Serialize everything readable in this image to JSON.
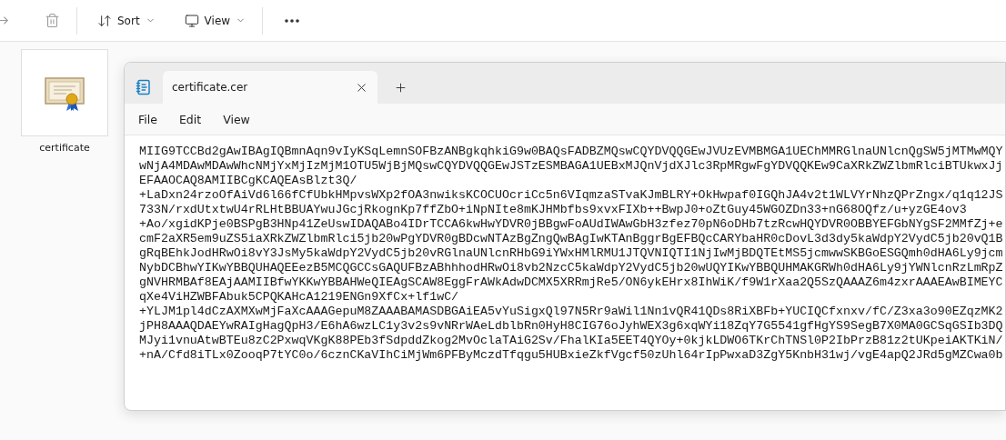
{
  "toolbar": {
    "items": [
      {
        "kind": "share"
      },
      {
        "kind": "delete"
      },
      {
        "kind": "sort",
        "label": "Sort"
      },
      {
        "kind": "view",
        "label": "View"
      },
      {
        "kind": "more"
      }
    ]
  },
  "file": {
    "name": "certificate"
  },
  "notepad": {
    "tabs": [
      {
        "title": "certificate.cer",
        "selected": true
      }
    ],
    "menu": [
      "File",
      "Edit",
      "View"
    ],
    "lines": [
      "MIIG9TCCBd2gAwIBAgIQBmnAqn9vIyKSqLemnSOFBzANBgkqhkiG9w0BAQsFADBZMQswCQYDVQQGEwJVUzEVMBMGA1UEChMMRGlnaUNlcnQgSW5jMTMwMQY",
      "wNjA4MDAwMDAwWhcNMjYxMjIzMjM1OTU5WjBjMQswCQYDVQQGEwJSTzESMBAGA1UEBxMJQnVjdXJlc3RpMRgwFgYDVQQKEw9CaXRkZWZlbmRlciBTUkwxJj",
      "EFAAOCAQ8AMIIBCgKCAQEAsBlzt3Q/",
      "+LaDxn24rzoOfAiVd6l66fCfUbkHMpvsWXp2fOA3nwiksKCOCUOcriCc5n6VIqmzaSTvaKJmBLRY+OkHwpaf0IGQhJA4v2t1WLVYrNhzQPrZngx/q1q12JS",
      "733N/rxdUtxtwU4rRLHtBBUAYwuJGcjRkognKp7ffZbO+iNpNIte8mKJHMbfbs9xvxFIXb++BwpJ0+oZtGuy45WGOZDn33+nG68OQfz/u+yzGE4ov3",
      "+Ao/xgidKPje0BSPgB3HNp41ZeUswIDAQABo4IDrTCCA6kwHwYDVR0jBBgwFoAUdIWAwGbH3zfez70pN6oDHb7tzRcwHQYDVR0OBBYEFGbNYgSF2MMfZj+e",
      "cmF2aXR5em9uZS5iaXRkZWZlbmRlci5jb20wPgYDVR0gBDcwNTAzBgZngQwBAgIwKTAnBggrBgEFBQcCARYbaHR0cDovL3d3dy5kaWdpY2VydC5jb20vQ1B",
      "gRqBEhkJodHRwOi8vY3JsMy5kaWdpY2VydC5jb20vRGlnaUNlcnRHbG9iYWxHMlRMU1JTQVNIQTI1NjIwMjBDQTEtMS5jcmwwSKBGoESGQmh0dHA6Ly9jcm",
      "NybDCBhwYIKwYBBQUHAQEEezB5MCQGCCsGAQUFBzABhhhodHRwOi8vb2NzcC5kaWdpY2VydC5jb20wUQYIKwYBBQUHMAKGRWh0dHA6Ly9jYWNlcnRzLmRpZ",
      "gNVHRMBAf8EAjAAMIIBfwYKKwYBBAHWeQIEAgSCAW8EggFrAWkAdwDCMX5XRRmjRe5/ON6ykEHrx8IhWiK/f9W1rXaa2Q5SzQAAAZ6m4zxrAAAEAwBIMEYC",
      "qXe4ViHZWBFAbuk5CPQKAHcA1219ENGn9XfCx+lf1wC/",
      "+YLJM1pl4dCzAXMXwMjFaXcAAAGepuM8ZAAABAMASDBGAiEA5vYuSigxQl97N5Rr9aWil1Nn1vQR41QDs8RiXBFb+YUCIQCfxnxv/fC/Z3xa3o90EZqzMK2",
      "jPH8AAAQDAEYwRAIgHagQpH3/E6hA6wzLC1y3v2s9vNRrWAeLdblbRn0HyH8CIG76oJyhWEX3g6xqWYi18ZqY7G5541gfHgYS9SegB7X0MA0GCSqGSIb3DQ",
      "MJyi1vnuAtwBTEu8zC2PxwqVKgK88PEb3fSdpddZkog2MvOclaTAiG2Sv/FhalKIa5EET4QYOy+0kjkLDWO6TKrChTNSl0P2IbPrzB81z2tUKpeiAKTKiN/",
      "+nA/Cfd8iTLx0ZooqP7tYC0o/6cznCKaVIhCiMjWm6PFByMczdTfqgu5HUBxieZkfVgcf50zUhl64rIpPwxaD3ZgY5KnbH31wj/vgE4apQ2JRd5gMZCwa0b"
    ]
  }
}
